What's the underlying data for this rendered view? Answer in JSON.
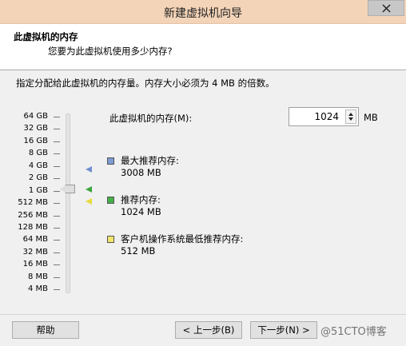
{
  "window": {
    "title": "新建虚拟机向导"
  },
  "header": {
    "title": "此虚拟机的内存",
    "subtitle": "您要为此虚拟机使用多少内存?"
  },
  "instruction": "指定分配给此虚拟机的内存量。内存大小必须为 4 MB 的倍数。",
  "scale": {
    "labels": [
      "64 GB",
      "32 GB",
      "16 GB",
      "8 GB",
      "4 GB",
      "2 GB",
      "1 GB",
      "512 MB",
      "256 MB",
      "128 MB",
      "64 MB",
      "32 MB",
      "16 MB",
      "8 MB",
      "4 MB"
    ],
    "selected": "1 GB"
  },
  "memory": {
    "label": "此虚拟机的内存(M):",
    "value": "1024",
    "unit": "MB"
  },
  "legend": {
    "max": {
      "label": "最大推荐内存:",
      "value": "3008 MB",
      "color": "#7b9bd3"
    },
    "recommended": {
      "label": "推荐内存:",
      "value": "1024 MB",
      "color": "#46b04a"
    },
    "minimum": {
      "label": "客户机操作系统最低推荐内存:",
      "value": "512 MB",
      "color": "#f2e66b"
    }
  },
  "footer": {
    "help": "帮助",
    "back": "< 上一步(B)",
    "next": "下一步(N) >"
  },
  "watermark": "@51CTO博客"
}
